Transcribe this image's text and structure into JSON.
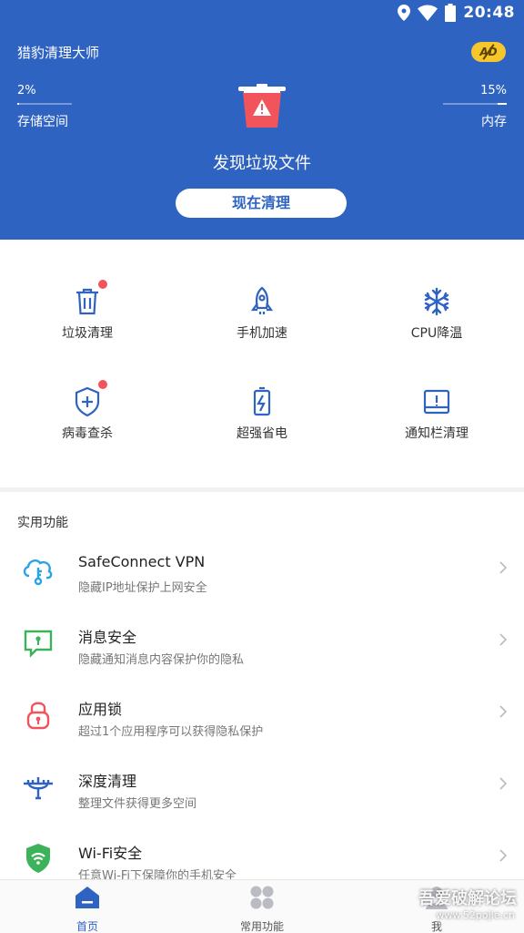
{
  "status_bar": {
    "time": "20:48",
    "icons": [
      "location-icon",
      "wifi-icon",
      "battery-icon"
    ]
  },
  "header": {
    "app_title": "猎豹清理大师",
    "ad_badge": "AD",
    "storage": {
      "value": "2%",
      "label": "存储空间",
      "progress": 0.02
    },
    "memory": {
      "value": "15%",
      "label": "内存",
      "progress": 0.15
    },
    "found_text": "发现垃圾文件",
    "clean_button": "现在清理"
  },
  "grid": {
    "items": [
      {
        "label": "垃圾清理",
        "icon": "trash-icon",
        "dot": true
      },
      {
        "label": "手机加速",
        "icon": "rocket-icon",
        "dot": false
      },
      {
        "label": "CPU降温",
        "icon": "snowflake-icon",
        "dot": false
      },
      {
        "label": "病毒查杀",
        "icon": "shield-plus-icon",
        "dot": true
      },
      {
        "label": "超强省电",
        "icon": "battery-icon",
        "dot": false
      },
      {
        "label": "通知栏清理",
        "icon": "notification-icon",
        "dot": false
      }
    ]
  },
  "section_title": "实用功能",
  "features": [
    {
      "title": "SafeConnect VPN",
      "subtitle": "隐藏IP地址保护上网安全",
      "icon": "vpn-cloud-icon",
      "color": "#29a3e8"
    },
    {
      "title": "消息安全",
      "subtitle": "隐藏通知消息内容保护你的隐私",
      "icon": "message-lock-icon",
      "color": "#3cb25a"
    },
    {
      "title": "应用锁",
      "subtitle": "超过1个应用程序可以获得隐私保护",
      "icon": "padlock-icon",
      "color": "#f2545b"
    },
    {
      "title": "深度清理",
      "subtitle": "整理文件获得更多空间",
      "icon": "deep-clean-icon",
      "color": "#2f63c1"
    },
    {
      "title": "Wi-Fi安全",
      "subtitle": "任意Wi-Fi下保障你的手机安全",
      "icon": "wifi-shield-icon",
      "color": "#3cb25a"
    }
  ],
  "bottom_nav": [
    {
      "label": "首页",
      "icon": "home-icon",
      "active": true
    },
    {
      "label": "常用功能",
      "icon": "apps-grid-icon",
      "active": false
    },
    {
      "label": "我",
      "icon": "profile-icon",
      "active": false
    }
  ],
  "watermark": {
    "text": "吾爱破解论坛",
    "url": "www.52pojie.cn"
  },
  "colors": {
    "primary": "#2f63c1",
    "alert": "#f2545b",
    "badge": "#f7c52c"
  }
}
